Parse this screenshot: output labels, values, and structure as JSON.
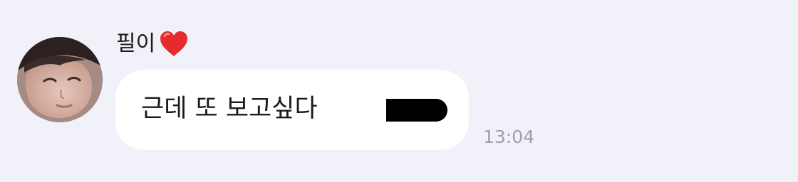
{
  "message": {
    "sender": {
      "name": "필이",
      "name_emoji": "heart-icon",
      "avatar": "profile-photo"
    },
    "text": "근데 또 보고싶다",
    "redacted": true,
    "time": "13:04"
  },
  "colors": {
    "background": "#f1f2f9",
    "bubble": "#ffffff",
    "text": "#1b1b1b",
    "timestamp": "#9ea0a5",
    "heart": "#e52b2b",
    "redaction": "#000000"
  }
}
